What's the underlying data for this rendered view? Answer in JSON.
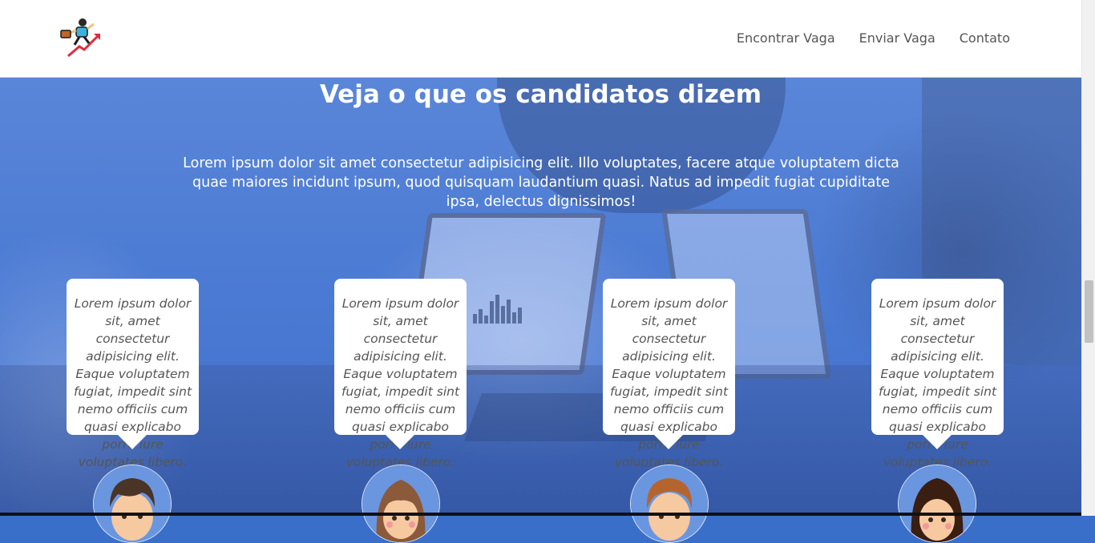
{
  "header": {
    "logo_icon": "businessman-running-up-arrow-icon",
    "nav": [
      {
        "label": "Encontrar Vaga"
      },
      {
        "label": "Enviar Vaga"
      },
      {
        "label": "Contato"
      }
    ]
  },
  "section": {
    "title": "Veja o que os candidatos dizem",
    "intro": "Lorem ipsum dolor sit amet consectetur adipisicing elit. Illo voluptates, facere atque voluptatem dicta quae maiores incidunt ipsum, quod quisquam laudantium quasi. Natus ad impedit fugiat cupiditate ipsa, delectus dignissimos!"
  },
  "testimonials": [
    {
      "text": "Lorem ipsum dolor sit, amet consectetur adipisicing elit. Eaque voluptatem fugiat, impedit sint nemo officiis cum quasi explicabo porro iure voluptates libero.",
      "avatar": "male-avatar-icon"
    },
    {
      "text": "Lorem ipsum dolor sit, amet consectetur adipisicing elit. Eaque voluptatem fugiat, impedit sint nemo officiis cum quasi explicabo porro iure voluptates libero.",
      "avatar": "female-avatar-icon"
    },
    {
      "text": "Lorem ipsum dolor sit, amet consectetur adipisicing elit. Eaque voluptatem fugiat, impedit sint nemo officiis cum quasi explicabo porro iure voluptates libero.",
      "avatar": "male-avatar-icon"
    },
    {
      "text": "Lorem ipsum dolor sit, amet consectetur adipisicing elit. Eaque voluptatem fugiat, impedit sint nemo officiis cum quasi explicabo porro iure voluptates libero.",
      "avatar": "female-avatar-icon"
    }
  ],
  "colors": {
    "overlay": "#4a7bd5",
    "card_text": "#555555",
    "nav_text": "#555555"
  }
}
